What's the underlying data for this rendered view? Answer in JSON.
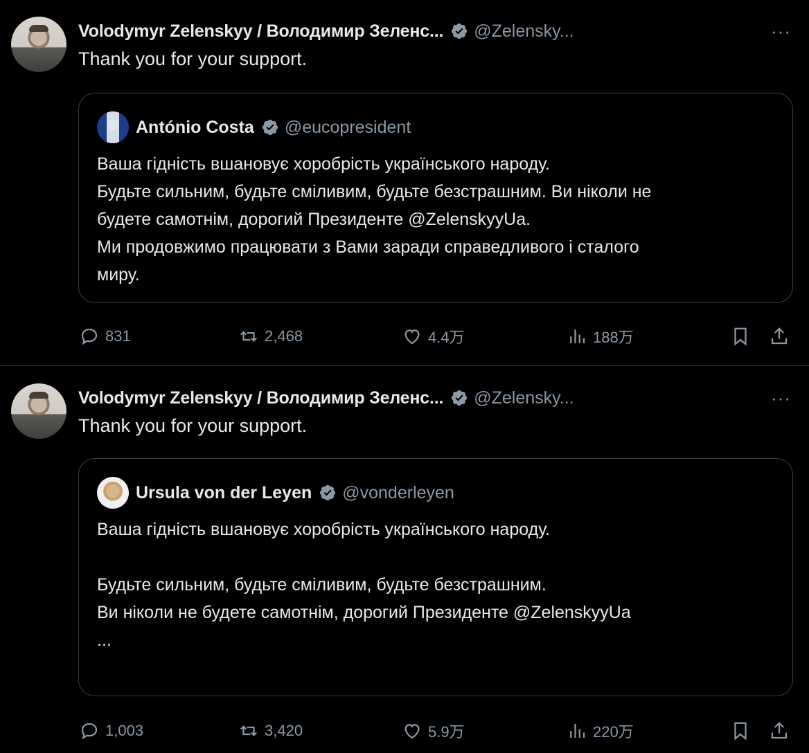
{
  "tweets": [
    {
      "author": {
        "name": "Volodymyr Zelenskyy / Володимир Зеленс...",
        "handle": "@Zelensky...",
        "avatar_icon": "avatar-photo"
      },
      "more_label": "···",
      "text": "Thank you for your support.",
      "quote": {
        "author": {
          "name": "António Costa",
          "handle": "@eucopresident"
        },
        "lines": [
          "Ваша гідність вшановує хоробрість українського народу.",
          "Будьте сильним, будьте сміливим, будьте безстрашним. Ви ніколи не",
          "будете самотнім, дорогий Президенте @ZelenskyyUa.",
          "Ми продовжимо працювати з Вами заради справедливого і сталого",
          "миру."
        ]
      },
      "stats": {
        "replies": "831",
        "reposts": "2,468",
        "likes": "4.4万",
        "views": "188万"
      }
    },
    {
      "author": {
        "name": "Volodymyr Zelenskyy / Володимир Зеленс...",
        "handle": "@Zelensky...",
        "avatar_icon": "avatar-photo"
      },
      "more_label": "···",
      "text": "Thank you for your support.",
      "quote": {
        "author": {
          "name": "Ursula von der Leyen",
          "handle": "@vonderleyen"
        },
        "lines": [
          "Ваша гідність вшановує хоробрість українського народу.",
          "",
          "Будьте сильним, будьте сміливим, будьте безстрашним.",
          "Ви ніколи не будете самотнім, дорогий Президенте @ZelenskyyUa",
          "..."
        ]
      },
      "stats": {
        "replies": "1,003",
        "reposts": "3,420",
        "likes": "5.9万",
        "views": "220万"
      }
    }
  ],
  "colors": {
    "background": "#000000",
    "text": "#e7e9ea",
    "muted": "#8b98a5",
    "verified": "#8b98a5",
    "border": "#3a3e42"
  },
  "icons": [
    "reply-icon",
    "retweet-icon",
    "like-icon",
    "views-icon",
    "bookmark-icon",
    "share-icon",
    "verified-badge-icon",
    "more-icon"
  ]
}
